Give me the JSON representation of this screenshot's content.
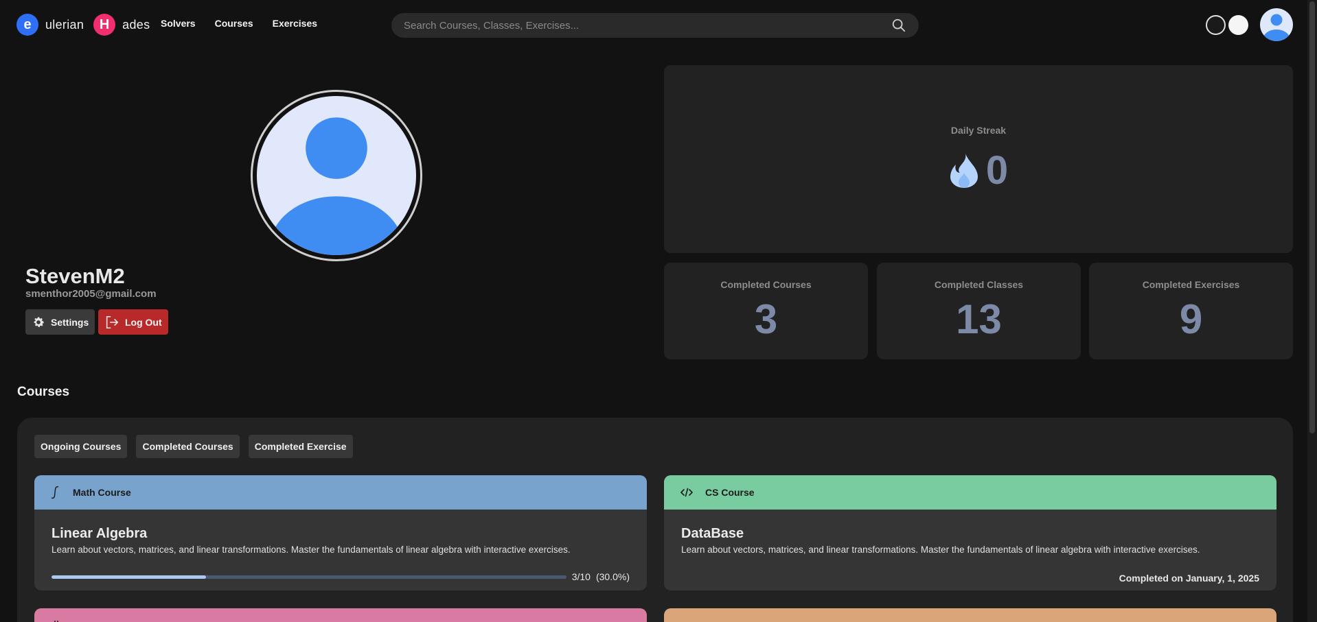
{
  "header": {
    "logo_primary_letter": "e",
    "logo_primary_word": "ulerian",
    "logo_secondary_letter": "H",
    "logo_secondary_word": "ades",
    "nav": [
      "Solvers",
      "Courses",
      "Exercises"
    ],
    "search_placeholder": "Search Courses, Classes, Exercises..."
  },
  "colors": {
    "eulerian_badge": "#2f6ff5",
    "hades_badge": "#ef2f6e",
    "math_header": "#78a3cc",
    "cs_header": "#79cc9f",
    "electronics_header": "#d97aa3",
    "physics_header": "#d9a579",
    "danger": "#b82a2a"
  },
  "profile": {
    "username": "StevenM2",
    "email": "smenthor2005@gmail.com",
    "settings_label": "Settings",
    "logout_label": "Log Out"
  },
  "stats": {
    "streak_label": "Daily Streak",
    "streak_value": "0",
    "completed_courses_label": "Completed Courses",
    "completed_courses_value": "3",
    "completed_classes_label": "Completed Classes",
    "completed_classes_value": "13",
    "completed_exercises_label": "Completed Exercises",
    "completed_exercises_value": "9"
  },
  "courses": {
    "section_title": "Courses",
    "tabs": [
      "Ongoing Courses",
      "Completed Courses",
      "Completed Exercise"
    ],
    "cards": [
      {
        "category": "Math Course",
        "icon": "integral-icon",
        "title": "Linear Algebra",
        "description": "Learn about vectors, matrices, and linear transformations. Master the fundamentals of linear algebra with interactive exercises.",
        "progress_text": "3/10",
        "progress_percent_text": "(30.0%)",
        "progress_fraction": 0.3
      },
      {
        "category": "CS Course",
        "icon": "code-icon",
        "title": "DataBase",
        "description": "Learn about vectors, matrices, and linear transformations. Master the fundamentals of linear algebra with interactive exercises.",
        "completed_text": "Completed on January, 1, 2025"
      },
      {
        "icon": "chip-icon"
      },
      {
        "icon": "atom-icon"
      }
    ]
  }
}
